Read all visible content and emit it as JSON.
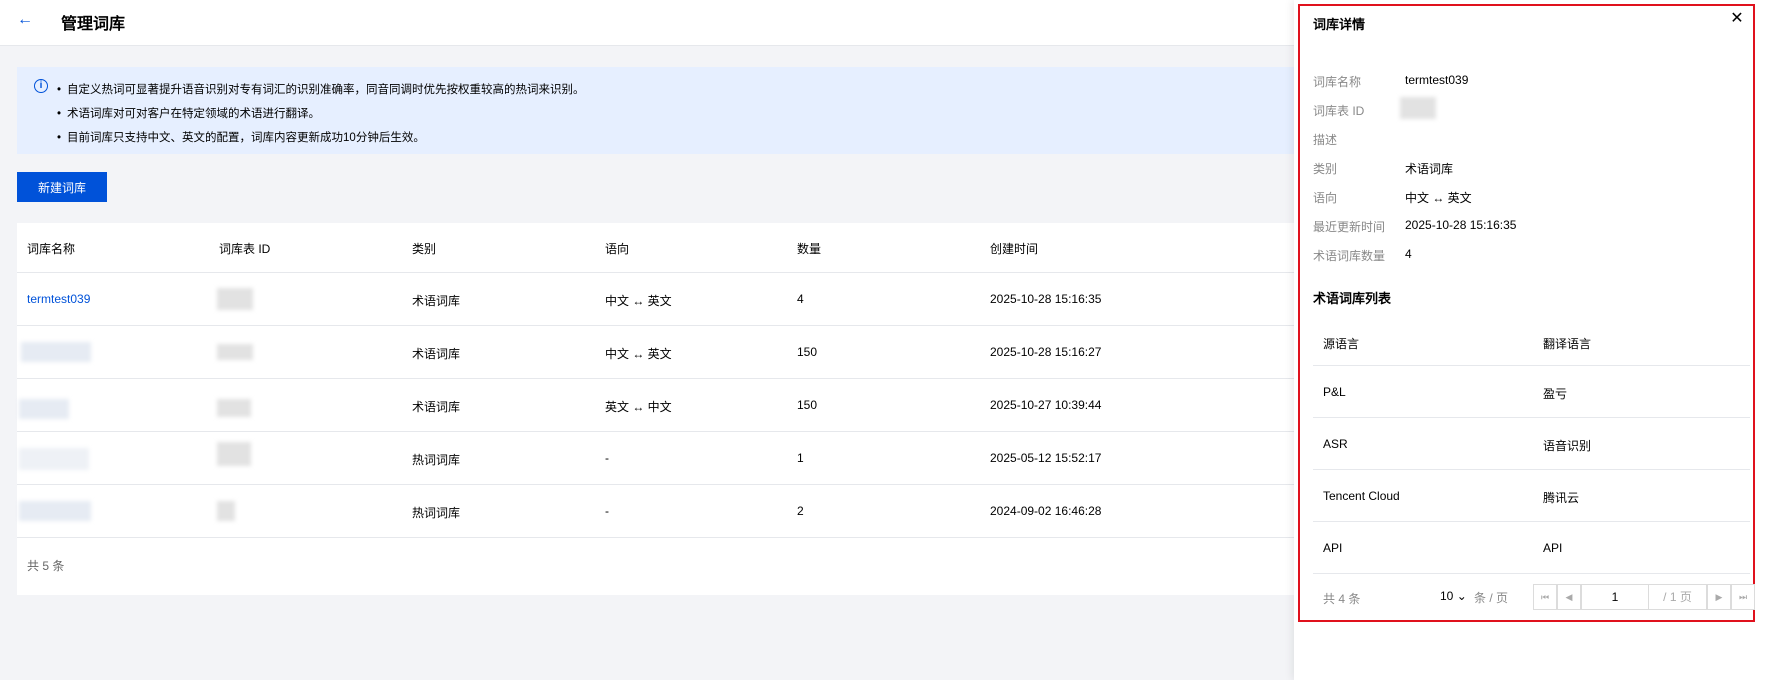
{
  "header": {
    "back_icon": "←",
    "title": "管理词库"
  },
  "alert": {
    "icon": "i",
    "lines": [
      "自定义热词可显著提升语音识别对专有词汇的识别准确率，同音同调时优先按权重较高的热词来识别。",
      "术语词库对可对客户在特定领域的术语进行翻译。",
      "目前词库只支持中文、英文的配置，词库内容更新成功10分钟后生效。"
    ]
  },
  "create_button": "新建词库",
  "table": {
    "columns": [
      "词库名称",
      "词库表 ID",
      "类别",
      "语向",
      "数量",
      "创建时间"
    ],
    "rows": [
      {
        "name": "termtest039",
        "type": "术语词库",
        "direction": "中文 ↔ 英文",
        "count": "4",
        "created": "2025-10-28 15:16:35"
      },
      {
        "name": "",
        "type": "术语词库",
        "direction": "中文 ↔ 英文",
        "count": "150",
        "created": "2025-10-28 15:16:27"
      },
      {
        "name": "",
        "type": "术语词库",
        "direction": "英文 ↔ 中文",
        "count": "150",
        "created": "2025-10-27 10:39:44"
      },
      {
        "name": "",
        "type": "热词词库",
        "direction": "-",
        "count": "1",
        "created": "2025-05-12 15:52:17"
      },
      {
        "name": "",
        "type": "热词词库",
        "direction": "-",
        "count": "2",
        "created": "2024-09-02 16:46:28"
      }
    ],
    "total": "共 5 条"
  },
  "drawer": {
    "title": "词库详情",
    "close_icon": "✕",
    "fields": [
      {
        "label": "词库名称",
        "value": "termtest039"
      },
      {
        "label": "词库表 ID",
        "value": ""
      },
      {
        "label": "描述",
        "value": ""
      },
      {
        "label": "类别",
        "value": "术语词库"
      },
      {
        "label": "语向",
        "value": "中文 ↔ 英文"
      },
      {
        "label": "最近更新时间",
        "value": "2025-10-28 15:16:35"
      },
      {
        "label": "术语词库数量",
        "value": "4"
      }
    ],
    "list_title": "术语词库列表",
    "list_columns": [
      "源语言",
      "翻译语言"
    ],
    "list_rows": [
      {
        "source": "P&L",
        "target": "盈亏"
      },
      {
        "source": "ASR",
        "target": "语音识别"
      },
      {
        "source": "Tencent Cloud",
        "target": "腾讯云"
      },
      {
        "source": "API",
        "target": "API"
      }
    ],
    "pager": {
      "total": "共 4 条",
      "page_size": "10",
      "page_size_caret": "⌄",
      "page_size_unit": "条 / 页",
      "first_icon": "⏮",
      "prev_icon": "◀",
      "current_page": "1",
      "page_of": "/ 1 页",
      "next_icon": "▶",
      "last_icon": "⏭"
    }
  },
  "colors": {
    "primary": "#0052d9",
    "alert_bg": "#e6efff",
    "highlight_border": "#e0111d"
  }
}
